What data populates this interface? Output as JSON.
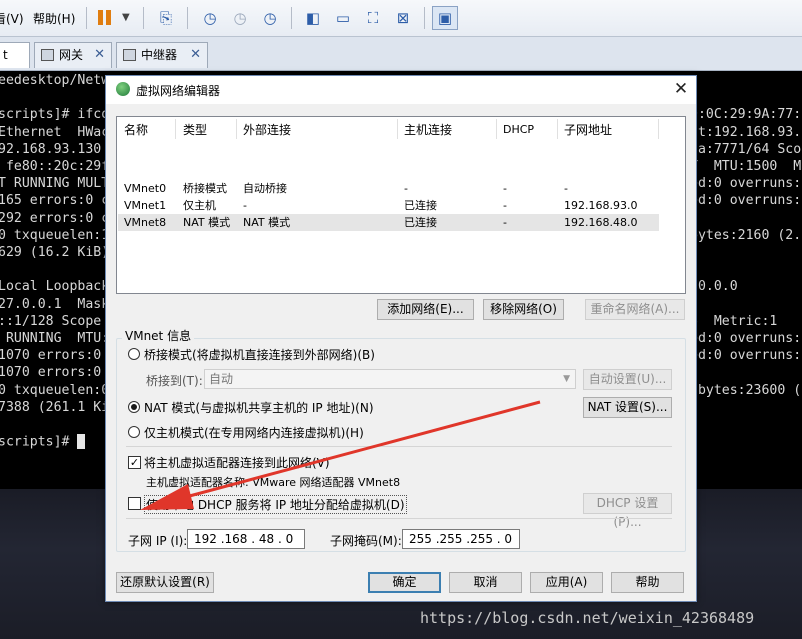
{
  "toolbar": {
    "menu_view": "查看(V)",
    "menu_help": "帮助(H)"
  },
  "tabs": [
    {
      "label": "t",
      "active": true
    },
    {
      "label": "网关",
      "active": false
    },
    {
      "label": "中继器",
      "active": false
    }
  ],
  "terminal": {
    "left": [
      "eedesktop/Netw",
      "",
      "scripts]# ifco",
      "Ethernet  HWac",
      "92.168.93.130",
      " fe80::20c:29f",
      "T RUNNING MULT",
      "165 errors:0 c",
      "292 errors:0 c",
      "0 txqueuelen:1",
      "629 (16.2 KiB)",
      "",
      "Local Loopback",
      "27.0.0.1  Mask",
      "::1/128 Scope",
      " RUNNING  MTU:",
      "1070 errors:0",
      "1070 errors:0",
      "0 txqueuelen:0",
      "7388 (261.1 Ki",
      "",
      "scripts]# "
    ],
    "right": [
      "",
      "",
      "0:0C:29:9A:77:",
      "st:192.168.93.",
      "9a:7771/64 Sco",
      "T  MTU:1500  M",
      "ed:0 overruns:",
      "ed:0 overruns:0",
      "",
      "bytes:2160 (2.1",
      "",
      "",
      ".0.0.0",
      "t",
      "6  Metric:1",
      "ed:0 overruns:",
      "ed:0 overruns:",
      "",
      " bytes:23600 (",
      "",
      "",
      ""
    ]
  },
  "dialog": {
    "title": "虚拟网络编辑器",
    "columns": [
      "名称",
      "类型",
      "外部连接",
      "主机连接",
      "DHCP",
      "子网地址"
    ],
    "rows": [
      [
        "VMnet0",
        "桥接模式",
        "自动桥接",
        "-",
        "-",
        "-"
      ],
      [
        "VMnet1",
        "仅主机",
        "-",
        "已连接",
        "-",
        "192.168.93.0"
      ],
      [
        "VMnet8",
        "NAT 模式",
        "NAT 模式",
        "已连接",
        "-",
        "192.168.48.0"
      ]
    ],
    "buttons": {
      "add_network": "添加网络(E)...",
      "remove_network": "移除网络(O)",
      "rename_network": "重命名网络(A)..."
    },
    "vmnet_info_label": "VMnet 信息",
    "bridge_mode": "桥接模式(将虚拟机直接连接到外部网络)(B)",
    "bridge_to_label": "桥接到(T):",
    "bridge_to_value": "自动",
    "auto_settings": "自动设置(U)...",
    "nat_mode": "NAT 模式(与虚拟机共享主机的 IP 地址)(N)",
    "nat_settings": "NAT 设置(S)...",
    "host_only_mode": "仅主机模式(在专用网络内连接虚拟机)(H)",
    "connect_adapter": "将主机虚拟适配器连接到此网络(V)",
    "adapter_name": "主机虚拟适配器名称: VMware 网络适配器 VMnet8",
    "use_dhcp": "使用本地 DHCP 服务将 IP 地址分配给虚拟机(D)",
    "dhcp_settings": "DHCP 设置(P)...",
    "subnet_ip_label": "子网 IP (I):",
    "subnet_ip_value": "192 .168 . 48  . 0",
    "subnet_mask_label": "子网掩码(M):",
    "subnet_mask_value": "255 .255 .255 . 0",
    "restore_defaults": "还原默认设置(R)",
    "ok": "确定",
    "cancel": "取消",
    "apply": "应用(A)",
    "help": "帮助"
  },
  "watermark": "https://blog.csdn.net/weixin_42368489",
  "colors": {
    "annotation_arrow": "#e0362a",
    "selected_row": "#e5e5e5"
  }
}
